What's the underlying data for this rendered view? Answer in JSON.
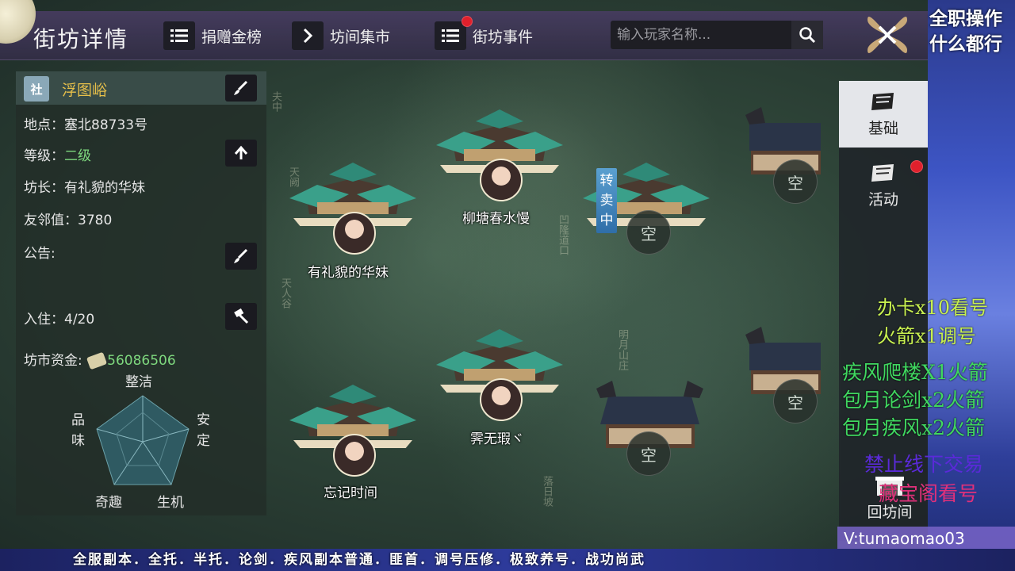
{
  "header": {
    "title": "街坊详情",
    "tabs": [
      {
        "label": "捐赠金榜",
        "icon": "list-icon"
      },
      {
        "label": "坊间集市",
        "icon": "chevron-right-icon"
      },
      {
        "label": "街坊事件",
        "icon": "list-icon",
        "has_notification": true
      }
    ],
    "search_placeholder": "输入玩家名称..."
  },
  "info_panel": {
    "badge": "社",
    "guild_name": "浮图峪",
    "location_label": "地点：",
    "location_value": "塞北88733号",
    "level_label": "等级：",
    "level_value": "二级",
    "leader_label": "坊长：",
    "leader_value": "有礼貌的华妹",
    "friendship_label": "友邻值：",
    "friendship_value": "3780",
    "notice_label": "公告:",
    "residents_label": "入住：",
    "residents_value": "4/20",
    "funds_label": "坊市资金:",
    "funds_value": "56086506",
    "radar": {
      "top": "整洁",
      "right": "安定",
      "bottom_right": "生机",
      "bottom_left": "奇趣",
      "left": "品味"
    }
  },
  "map": {
    "transfer_tag": [
      "转",
      "卖",
      "中"
    ],
    "empty_label": "空",
    "residents": [
      {
        "name": "有礼貌的华妹"
      },
      {
        "name": "柳塘春水慢"
      },
      {
        "name": "霁无瑕ヾ"
      },
      {
        "name": "忘记时间"
      }
    ],
    "background_labels": [
      "夫中",
      "天阙",
      "天人谷",
      "凹隆道口",
      "明月山庄",
      "落日坡"
    ]
  },
  "side_tabs": [
    {
      "label": "基础",
      "active": true
    },
    {
      "label": "活动",
      "active": false,
      "has_notification": true
    }
  ],
  "return_button": "回坊间",
  "overlay": {
    "top_line1": "全职操作",
    "top_line2": "什么都行",
    "promo1": "办卡x10看号",
    "promo2": "火箭x1调号",
    "list1": "疾风爬楼X1火箭",
    "list2": "包月论剑x2火箭",
    "list3": "包月疾风x2火箭",
    "warn1": "禁止线下交易",
    "warn2": "藏宝阁看号",
    "wechat": "V:tumaomao03",
    "bottom_banner": "全服副本．全托．半托．论剑．疾风副本普通．匪首．调号压修．极致养号．战功尚武"
  },
  "colors": {
    "guild_name": "#e8c04a",
    "level": "#7ed87e",
    "funds": "#7ed87e",
    "notification": "#e0202c",
    "transfer_tag": "#4a8ec0"
  }
}
